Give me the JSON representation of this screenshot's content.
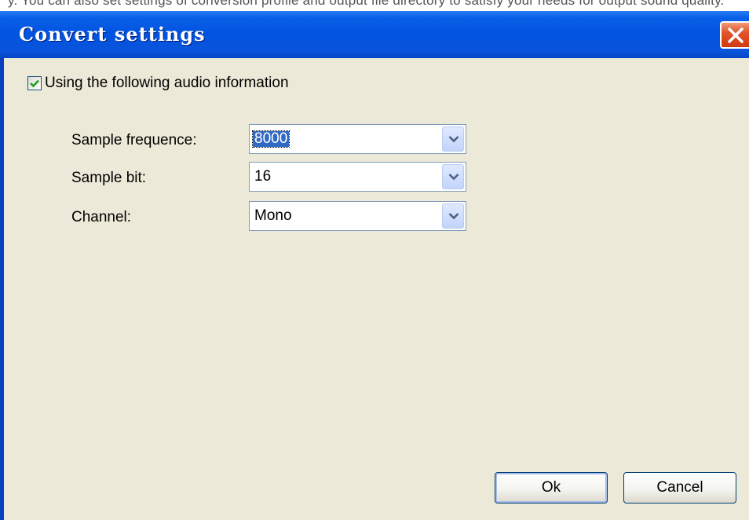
{
  "background_window": {
    "cutoff_text": "y. You can also set settings of conversion profile and output file directory to satisfy your needs for output sound quality."
  },
  "dialog": {
    "title": "Convert settings",
    "close_icon": "close-icon"
  },
  "audio_info": {
    "checkbox_label": "Using the following audio information",
    "checked": true
  },
  "fields": [
    {
      "label": "Sample frequence:",
      "value": "8000",
      "selected": true
    },
    {
      "label": "Sample bit:",
      "value": "16",
      "selected": false
    },
    {
      "label": "Channel:",
      "value": "Mono",
      "selected": false
    }
  ],
  "buttons": {
    "ok_label": "Ok",
    "cancel_label": "Cancel"
  },
  "colors": {
    "titlebar": "#0053e0",
    "dialog_body": "#ece9d8",
    "close_button": "#e2542b",
    "selection": "#316ac5"
  }
}
